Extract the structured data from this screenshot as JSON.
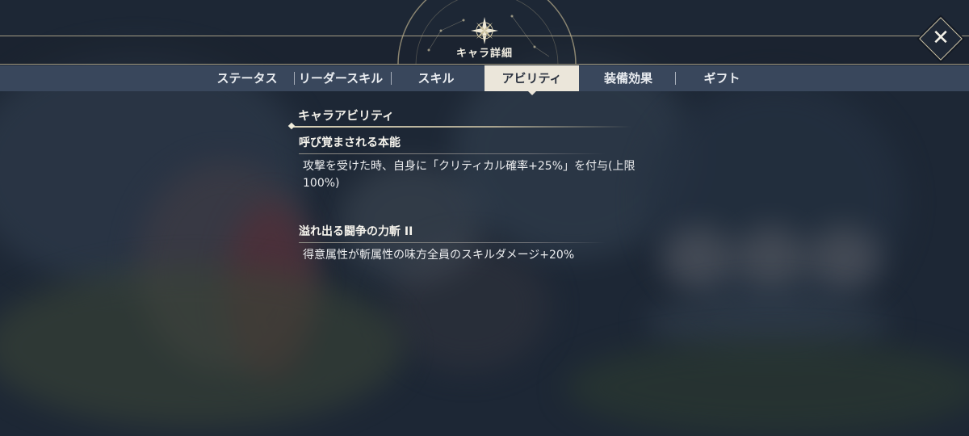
{
  "header": {
    "title": "キャラ詳細",
    "close_icon": "close-icon"
  },
  "tabs": [
    {
      "label": "ステータス",
      "active": false
    },
    {
      "label": "リーダースキル",
      "active": false
    },
    {
      "label": "スキル",
      "active": false
    },
    {
      "label": "アビリティ",
      "active": true
    },
    {
      "label": "装備効果",
      "active": false
    },
    {
      "label": "ギフト",
      "active": false
    }
  ],
  "section": {
    "header": "キャラアビリティ"
  },
  "abilities": [
    {
      "name": "呼び覚まされる本能",
      "description": "攻撃を受けた時、自身に「クリティカル確率+25%」を付与(上限100%)"
    },
    {
      "name": "溢れ出る闘争の力斬 II",
      "description": "得意属性が斬属性の味方全員のスキルダメージ+20%"
    }
  ],
  "colors": {
    "accent_gold": "#cfc6a8",
    "tab_bar": "#39475c",
    "active_tab": "#ebe6da",
    "background": "#1d2735"
  }
}
